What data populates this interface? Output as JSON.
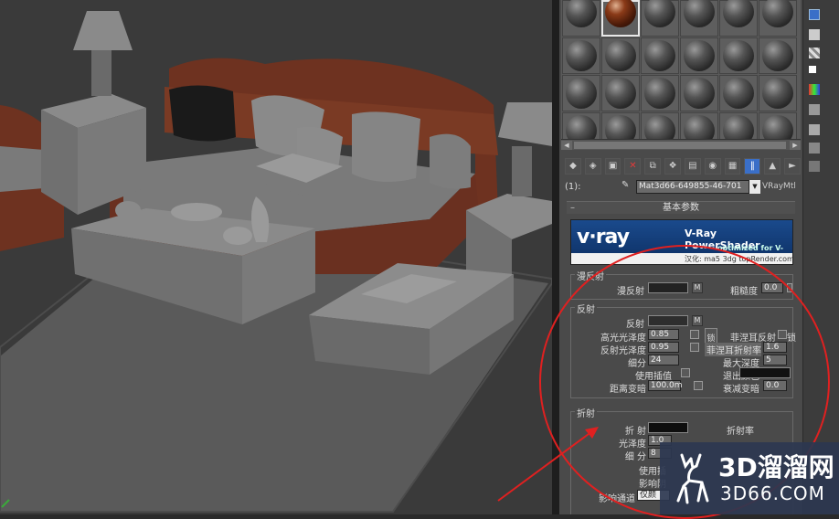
{
  "material_editor": {
    "slot_count": 24,
    "active_slot_index": 1,
    "material_index_label": "(1):",
    "material_name": "Mat3d66-649855-46-701",
    "material_type": "VRayMtl",
    "rollout_title": "基本参数",
    "banner": {
      "logo": "v·ray",
      "product": "V-Ray PowerShader",
      "optimized": "optimized for V-Ray",
      "credit": "汉化: ma5 3dg topRender.com"
    },
    "diffuse": {
      "group_title": "漫反射",
      "diffuse_label": "漫反射",
      "m_label": "M",
      "roughness_label": "粗糙度",
      "roughness_value": "0.0"
    },
    "reflection": {
      "group_title": "反射",
      "reflect_label": "反射",
      "m_label": "M",
      "hilight_gloss_label": "高光光泽度",
      "hilight_gloss_value": "0.85",
      "lock_label": "锁",
      "fresnel_label": "菲涅耳反射",
      "lock_label_2": "锁",
      "refl_gloss_label": "反射光泽度",
      "refl_gloss_value": "0.95",
      "fresnel_ior_label": "菲涅耳折射率",
      "fresnel_ior_value": "1.6",
      "subdivs_label": "细分",
      "subdivs_value": "24",
      "max_depth_label": "最大深度",
      "max_depth_value": "5",
      "use_interp_label": "使用插值",
      "exit_color_label": "退出颜色",
      "dim_distance_label": "距离变暗",
      "dim_distance_value": "100.0m",
      "dim_falloff_label": "衰减变暗",
      "dim_falloff_value": "0.0"
    },
    "refraction": {
      "group_title": "折射",
      "refract_label": "折 射",
      "ior_label": "折射率",
      "gloss_label": "光泽度",
      "gloss_value": "1.0",
      "subdivs_label": "细 分",
      "subdivs_value": "8",
      "use_interp_label": "使用插",
      "affect_shadows_label": "影响阴",
      "affect_channels_label": "影响通道",
      "affect_channels_value": "仅颜"
    }
  },
  "watermark": {
    "line1": "3D溜溜网",
    "line2": "3D66.COM"
  },
  "colors": {
    "annotation_red": "#e02020",
    "vray_blue": "#1a4a8c"
  }
}
